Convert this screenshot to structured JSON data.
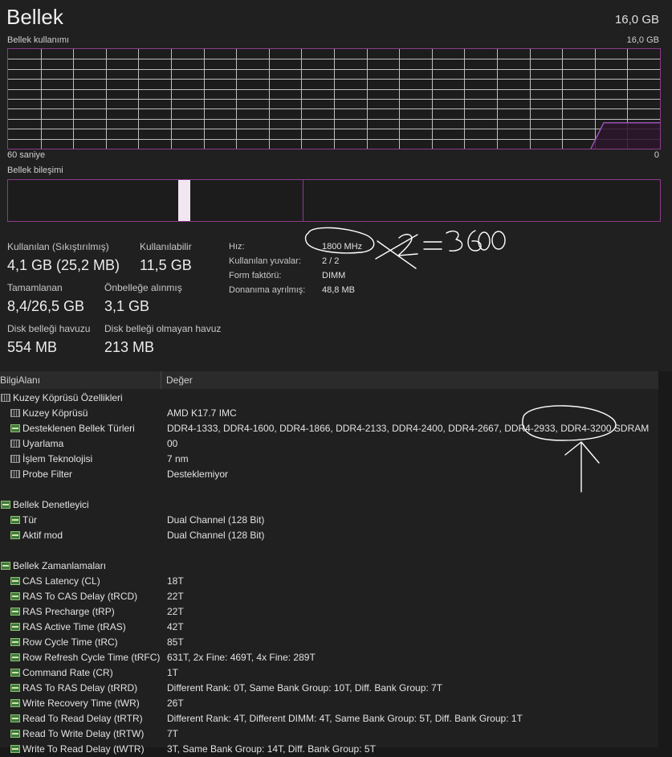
{
  "header": {
    "title": "Bellek",
    "total": "16,0 GB"
  },
  "graph": {
    "label": "Bellek kullanımı",
    "max_label": "16,0 GB",
    "left_time": "60 saniye",
    "right_time": "0",
    "usage_fraction": 0.26
  },
  "composition": {
    "label": "Bellek bileşimi"
  },
  "stats": {
    "in_use_label": "Kullanılan (Sıkıştırılmış)",
    "in_use_value": "4,1 GB (25,2 MB)",
    "available_label": "Kullanılabilir",
    "available_value": "11,5 GB",
    "committed_label": "Tamamlanan",
    "committed_value": "8,4/26,5 GB",
    "cached_label": "Önbelleğe alınmış",
    "cached_value": "3,1 GB",
    "paged_label": "Disk belleği havuzu",
    "paged_value": "554 MB",
    "nonpaged_label": "Disk belleği olmayan havuz",
    "nonpaged_value": "213 MB"
  },
  "right_stats": [
    {
      "label": "Hız:",
      "value": "1800 MHz"
    },
    {
      "label": "Kullanılan yuvalar:",
      "value": "2 / 2"
    },
    {
      "label": "Form faktörü:",
      "value": "DIMM"
    },
    {
      "label": "Donanıma ayrılmış:",
      "value": "48,8 MB"
    }
  ],
  "annotations": {
    "speed_note": "x2 = 3600"
  },
  "table": {
    "col1": "BilgiAlanı",
    "col2": "Değer",
    "rows": [
      {
        "type": "group",
        "icon": "chip",
        "label": "Kuzey Köprüsü Özellikleri",
        "value": ""
      },
      {
        "type": "item",
        "icon": "chip",
        "label": "Kuzey Köprüsü",
        "value": "AMD K17.7 IMC"
      },
      {
        "type": "item",
        "icon": "mem",
        "label": "Desteklenen Bellek Türleri",
        "value": "DDR4-1333, DDR4-1600, DDR4-1866, DDR4-2133, DDR4-2400, DDR4-2667, DDR4-2933, DDR4-3200 SDRAM"
      },
      {
        "type": "item",
        "icon": "chip",
        "label": "Uyarlama",
        "value": "00"
      },
      {
        "type": "item",
        "icon": "chip",
        "label": "İşlem Teknolojisi",
        "value": "7 nm"
      },
      {
        "type": "item",
        "icon": "chip",
        "label": "Probe Filter",
        "value": "Desteklemiyor"
      },
      {
        "type": "blank",
        "icon": "",
        "label": "",
        "value": ""
      },
      {
        "type": "group",
        "icon": "mem",
        "label": "Bellek Denetleyici",
        "value": ""
      },
      {
        "type": "item",
        "icon": "mem",
        "label": "Tür",
        "value": "Dual Channel  (128 Bit)"
      },
      {
        "type": "item",
        "icon": "mem",
        "label": "Aktif mod",
        "value": "Dual Channel  (128 Bit)"
      },
      {
        "type": "blank",
        "icon": "",
        "label": "",
        "value": ""
      },
      {
        "type": "group",
        "icon": "mem",
        "label": "Bellek Zamanlamaları",
        "value": ""
      },
      {
        "type": "item",
        "icon": "mem",
        "label": "CAS Latency (CL)",
        "value": "18T"
      },
      {
        "type": "item",
        "icon": "mem",
        "label": "RAS To CAS Delay (tRCD)",
        "value": "22T"
      },
      {
        "type": "item",
        "icon": "mem",
        "label": "RAS Precharge (tRP)",
        "value": "22T"
      },
      {
        "type": "item",
        "icon": "mem",
        "label": "RAS Active Time (tRAS)",
        "value": "42T"
      },
      {
        "type": "item",
        "icon": "mem",
        "label": "Row Cycle Time (tRC)",
        "value": "85T"
      },
      {
        "type": "item",
        "icon": "mem",
        "label": "Row Refresh Cycle Time (tRFC)",
        "value": "631T, 2x Fine: 469T, 4x Fine: 289T"
      },
      {
        "type": "item",
        "icon": "mem",
        "label": "Command Rate (CR)",
        "value": "1T"
      },
      {
        "type": "item",
        "icon": "mem",
        "label": "RAS To RAS Delay (tRRD)",
        "value": "Different Rank: 0T, Same Bank Group: 10T, Diff. Bank Group: 7T"
      },
      {
        "type": "item",
        "icon": "mem",
        "label": "Write Recovery Time (tWR)",
        "value": "26T"
      },
      {
        "type": "item",
        "icon": "mem",
        "label": "Read To Read Delay (tRTR)",
        "value": "Different Rank: 4T, Different DIMM: 4T, Same Bank Group: 5T, Diff. Bank Group: 1T"
      },
      {
        "type": "item",
        "icon": "mem",
        "label": "Read To Write Delay (tRTW)",
        "value": "7T"
      },
      {
        "type": "item",
        "icon": "mem",
        "label": "Write To Read Delay (tWTR)",
        "value": "3T, Same Bank Group: 14T, Diff. Bank Group: 5T"
      }
    ]
  },
  "colors": {
    "accent": "#8a3c8a",
    "line": "#9b4fb0",
    "background": "#202020"
  }
}
